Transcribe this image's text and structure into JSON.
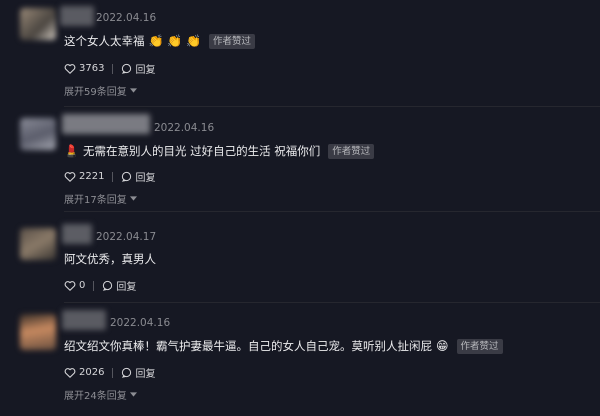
{
  "comments": [
    {
      "date": "2022.04.16",
      "text": "这个女人太幸福",
      "emoji_suffix": "👏 👏 👏",
      "author_liked_badge": "作者赞过",
      "likes": "3763",
      "reply_label": "回复",
      "expand_label": "展开59条回复"
    },
    {
      "date": "2022.04.16",
      "emoji_prefix": "💄",
      "text": "无需在意别人的目光 过好自己的生活 祝福你们",
      "author_liked_badge": "作者赞过",
      "likes": "2221",
      "reply_label": "回复",
      "expand_label": "展开17条回复"
    },
    {
      "date": "2022.04.17",
      "text": "阿文优秀，真男人",
      "likes": "0",
      "reply_label": "回复"
    },
    {
      "date": "2022.04.16",
      "text": "绍文绍文你真棒！霸气护妻最牛逼。自己的女人自己宠。莫听别人扯闲屁",
      "emoji_suffix": "😁",
      "author_liked_badge": "作者赞过",
      "likes": "2026",
      "reply_label": "回复",
      "expand_label": "展开24条回复"
    }
  ],
  "colors": {
    "background": "#161823",
    "badge_bg": "#3a3b45",
    "muted_text": "#8a8b91"
  },
  "icons": {
    "like": "heart-outline-icon",
    "reply": "speech-bubble-icon",
    "expand": "chevron-down-icon"
  }
}
